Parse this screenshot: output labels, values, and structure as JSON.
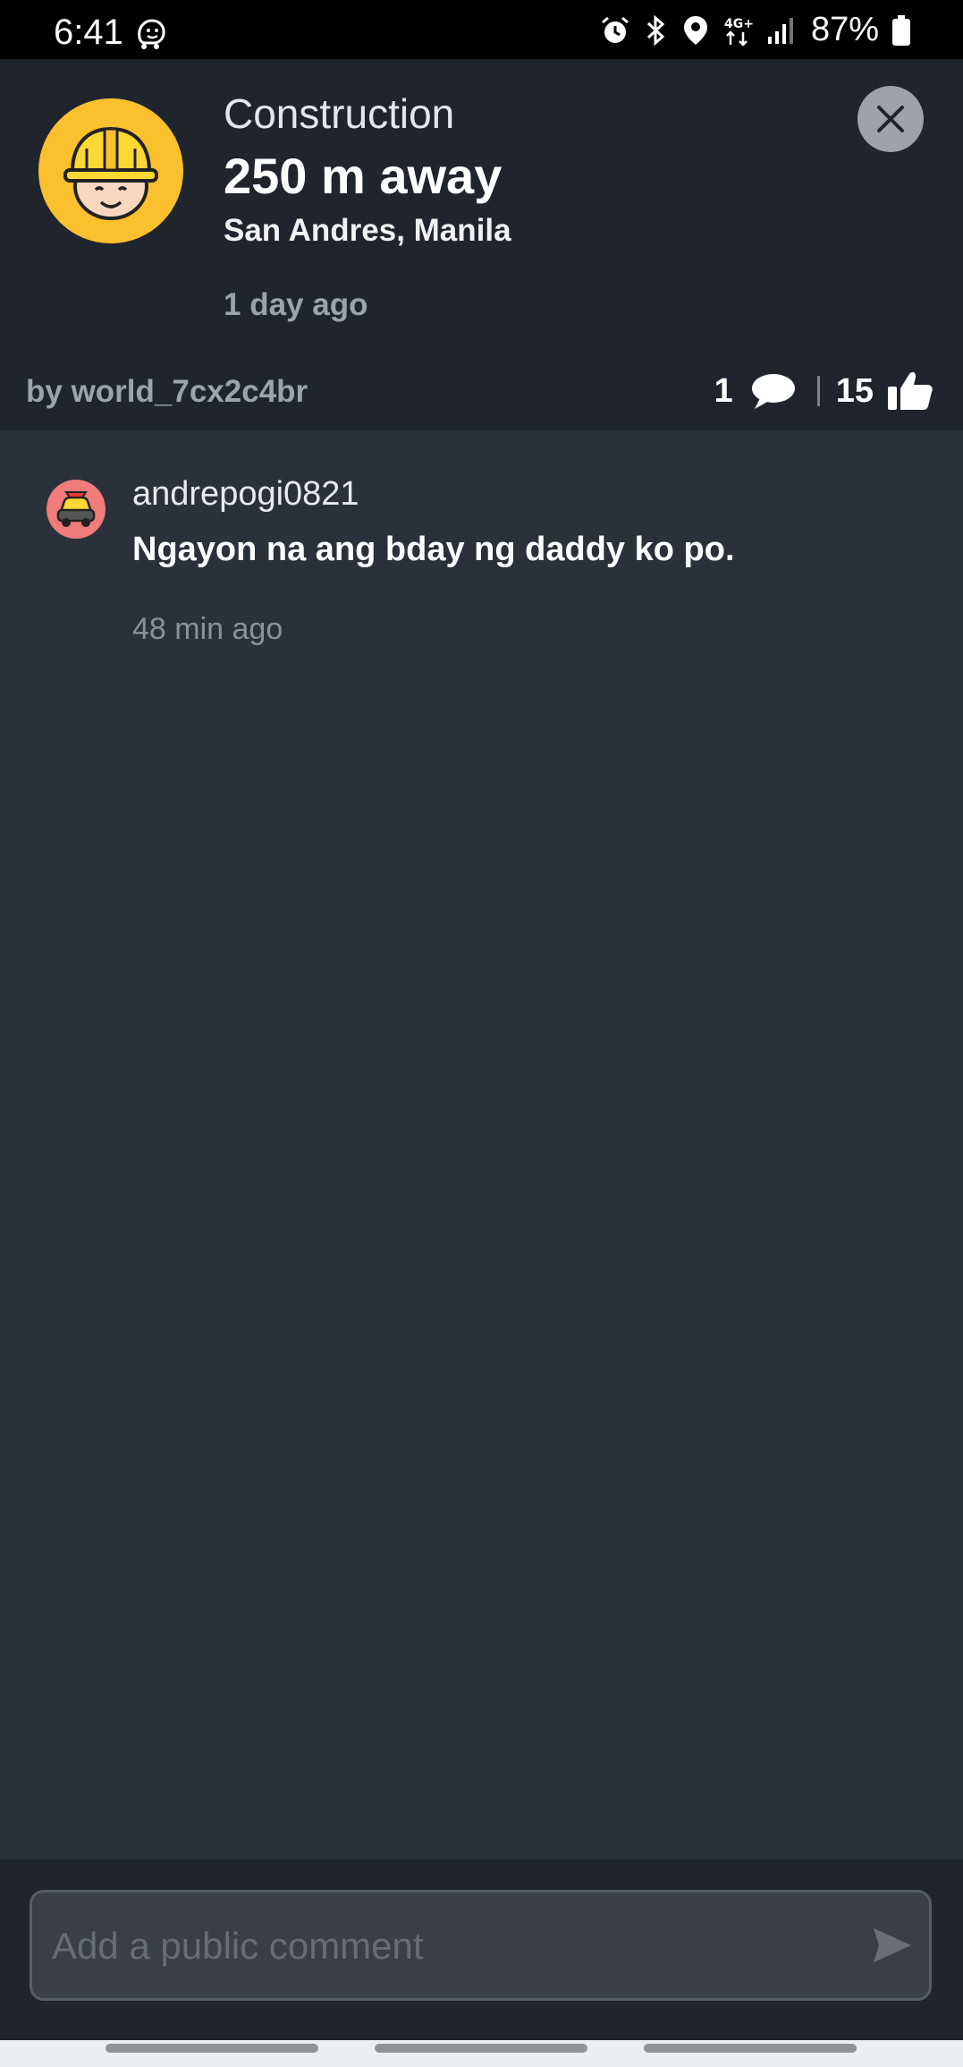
{
  "status_bar": {
    "time": "6:41",
    "battery": "87%",
    "icons": [
      "waze-icon",
      "alarm-icon",
      "bluetooth-icon",
      "location-icon",
      "network-4g-icon",
      "signal-icon",
      "battery-icon"
    ]
  },
  "alert": {
    "type": "Construction",
    "distance": "250 m away",
    "location": "San Andres, Manila",
    "time": "1 day ago",
    "reporter": "by world_7cx2c4br",
    "comment_count": "1",
    "thumbs_up_count": "15",
    "icon": "construction-worker-avatar",
    "accent_color": "#fbc02d"
  },
  "comments": [
    {
      "username": "andrepogi0821",
      "text": "Ngayon na ang bday ng daddy ko po.",
      "time": "48 min ago",
      "avatar": "wazer-car-avatar",
      "avatar_color": "#f07b7b"
    }
  ],
  "composer": {
    "placeholder": "Add a public comment",
    "value": ""
  },
  "colors": {
    "header_bg": "#1f242d",
    "body_bg": "#2a313b"
  }
}
